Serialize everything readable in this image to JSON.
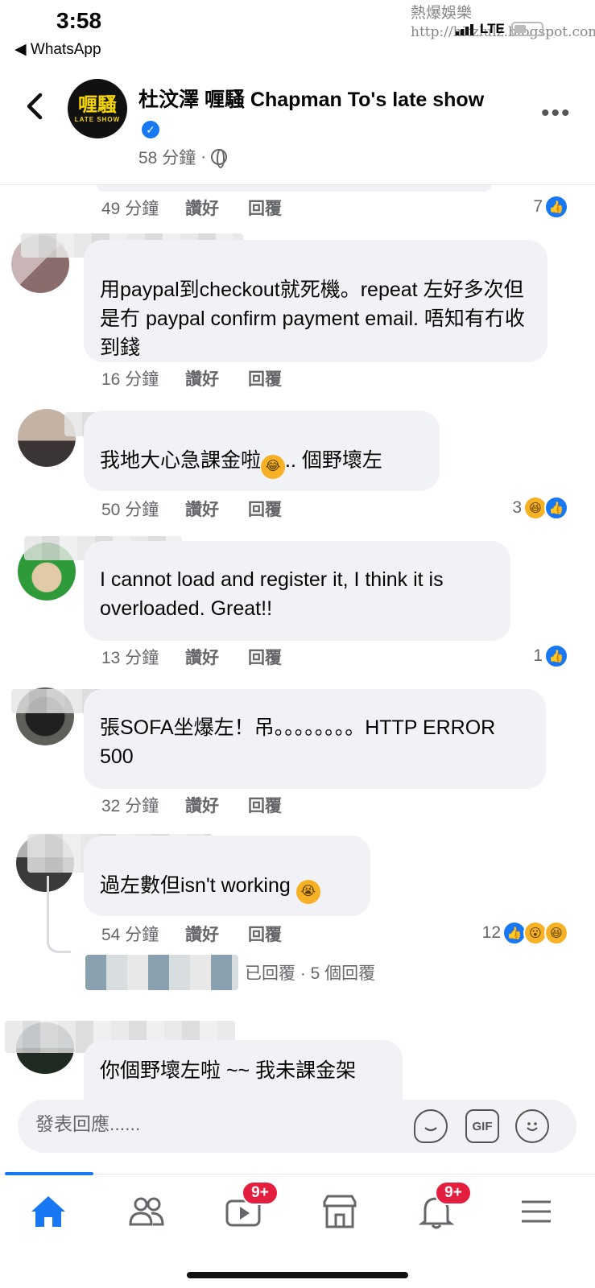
{
  "status_bar": {
    "time": "3:58",
    "back_app": "◀ WhatsApp",
    "network": "LTE",
    "watermark_line1": "熱爆娛樂",
    "watermark_line2": "http://hitzlulz.blogspot.com"
  },
  "header": {
    "logo_text": "喱騷",
    "logo_sub": "LATE SHOW",
    "title": "杜汶澤 喱騷 Chapman To's late show",
    "verified_icon": "✓",
    "post_time": "58 分鐘",
    "separator": "·",
    "more_label": "•••"
  },
  "comments": [
    {
      "text": "",
      "time": "49 分鐘",
      "like": "讚好",
      "reply": "回覆",
      "reaction_count": "7",
      "reactions": [
        "like"
      ]
    },
    {
      "text": "用paypal到checkout就死機。repeat 左好多次但是冇 paypal confirm payment email. 唔知有冇收到錢",
      "time": "16 分鐘",
      "like": "讚好",
      "reply": "回覆",
      "reaction_count": "",
      "reactions": []
    },
    {
      "text": "我地大心急課金啦",
      "text_after": ".. 個野壞左",
      "time": "50 分鐘",
      "like": "讚好",
      "reply": "回覆",
      "reaction_count": "3",
      "reactions": [
        "haha",
        "like"
      ]
    },
    {
      "text": "I cannot load and register it, I think it is overloaded. Great!!",
      "time": "13 分鐘",
      "like": "讚好",
      "reply": "回覆",
      "reaction_count": "1",
      "reactions": [
        "like"
      ]
    },
    {
      "text": "張SOFA坐爆左！吊。。。。。。。。HTTP ERROR 500",
      "time": "32 分鐘",
      "like": "讚好",
      "reply": "回覆",
      "reaction_count": "",
      "reactions": []
    },
    {
      "text": "過左數但isn't working",
      "time": "54 分鐘",
      "like": "讚好",
      "reply": "回覆",
      "reaction_count": "12",
      "reactions": [
        "like",
        "wow",
        "haha"
      ],
      "replies_summary": "已回覆 · 5 個回覆"
    },
    {
      "text": "你個野壞左啦 ~~ 我未課金架"
    }
  ],
  "composer": {
    "placeholder": "發表回應......",
    "gif_label": "GIF"
  },
  "bottom_nav": {
    "video_badge": "9+",
    "notifications_badge": "9+"
  },
  "colors": {
    "accent": "#1877f2",
    "bubble": "#f0f2f5",
    "muted_text": "#65676b",
    "badge": "#e41e3f",
    "emoji": "#f7b125"
  }
}
